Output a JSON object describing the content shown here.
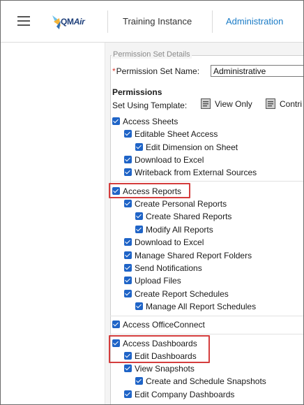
{
  "header": {
    "logo_text": "QM",
    "logo_text_italic": "Air",
    "nav_training": "Training Instance",
    "nav_admin": "Administration"
  },
  "form": {
    "legend": "Permission Set Details",
    "required_marker": "*",
    "name_label": "Permission Set Name:",
    "name_value": "Administrative",
    "permissions_title": "Permissions",
    "template_label": "Set Using Template:",
    "template_view_only": "View Only",
    "template_contrib": "Contri"
  },
  "permissions": {
    "access_sheets": "Access Sheets",
    "editable_sheet_access": "Editable Sheet Access",
    "edit_dimension_on_sheet": "Edit Dimension on Sheet",
    "download_to_excel_sheets": "Download to Excel",
    "writeback": "Writeback from External Sources",
    "access_reports": "Access Reports",
    "create_personal_reports": "Create Personal Reports",
    "create_shared_reports": "Create Shared Reports",
    "modify_all_reports": "Modify All Reports",
    "download_to_excel_reports": "Download to Excel",
    "manage_shared_report_folders": "Manage Shared Report Folders",
    "send_notifications": "Send Notifications",
    "upload_files": "Upload Files",
    "create_report_schedules": "Create Report Schedules",
    "manage_all_report_schedules": "Manage All Report Schedules",
    "access_officeconnect": "Access OfficeConnect",
    "access_dashboards": "Access Dashboards",
    "edit_dashboards": "Edit Dashboards",
    "view_snapshots": "View Snapshots",
    "create_schedule_snapshots": "Create and Schedule Snapshots",
    "edit_company_dashboards": "Edit Company Dashboards"
  },
  "colors": {
    "accent": "#1a7bc6",
    "checkbox": "#1f64c7",
    "highlight": "#d43d3d",
    "required": "#d9342b"
  }
}
